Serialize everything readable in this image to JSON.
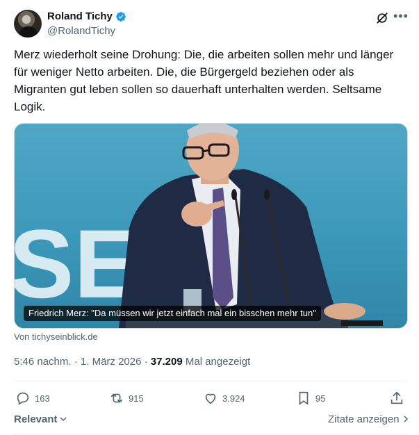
{
  "author": {
    "name": "Roland Tichy",
    "handle": "@RolandTichy"
  },
  "tweet": {
    "text": "Merz wiederholt seine Drohung: Die, die arbeiten sollen mehr und länger für weniger Netto arbeiten. Die, die Bürgergeld beziehen oder als Migranten gut leben sollen so dauerhaft unterhalten werden. Seltsame Logik."
  },
  "media": {
    "caption": "Friedrich Merz: \"Da müssen wir jetzt einfach mal ein bisschen mehr tun\"",
    "source": "Von tichyseinblick.de"
  },
  "meta": {
    "time": "5:46 nachm.",
    "date": "1. März 2026",
    "views": "37.209",
    "views_label": "Mal angezeigt"
  },
  "actions": {
    "replies": "163",
    "reposts": "915",
    "likes": "3.924",
    "bookmarks": "95"
  },
  "footer": {
    "sort_label": "Relevant",
    "quotes_label": "Zitate anzeigen"
  },
  "colors": {
    "verified": "#1d9bf0",
    "muted": "#536471",
    "text": "#0f1419"
  }
}
